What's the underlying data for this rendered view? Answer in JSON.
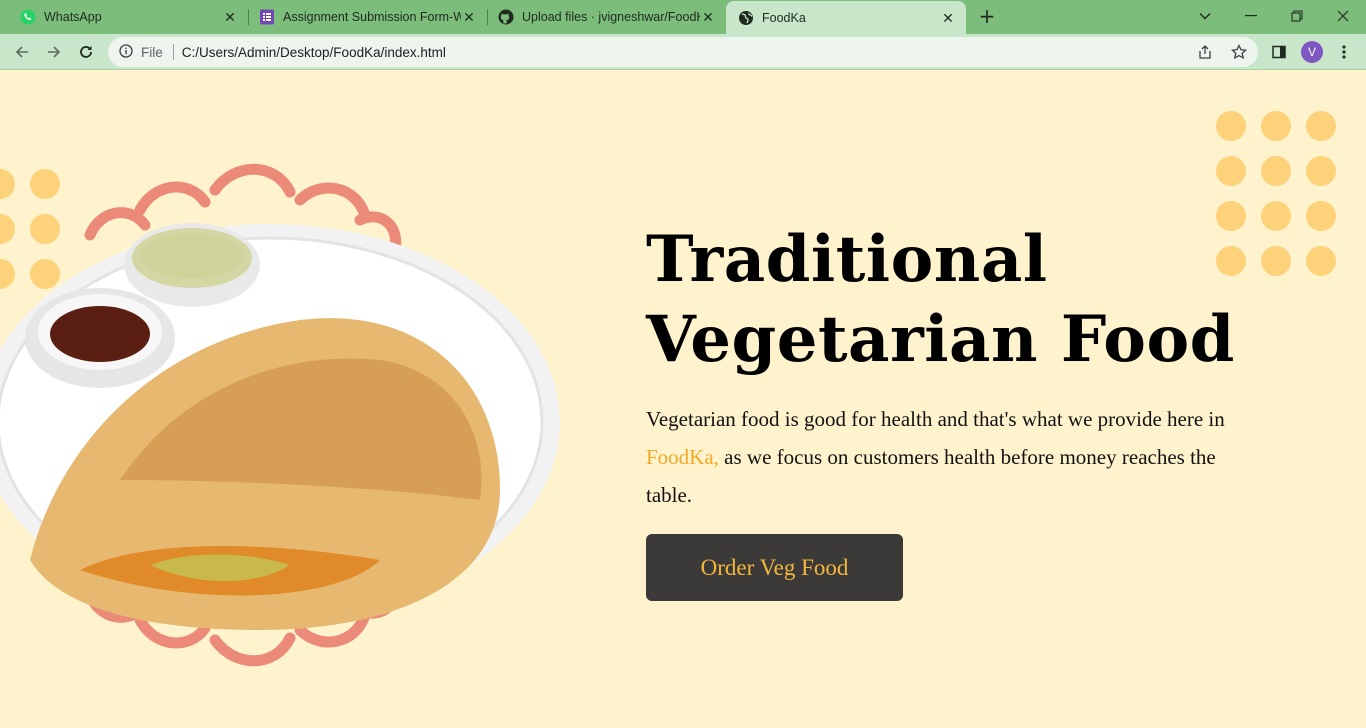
{
  "browser": {
    "tabs": [
      {
        "title": "WhatsApp",
        "icon": "whatsapp-icon",
        "active": false
      },
      {
        "title": "Assignment Submission Form-W",
        "icon": "google-forms-icon",
        "active": false
      },
      {
        "title": "Upload files · jvigneshwar/FoodKa",
        "icon": "github-icon",
        "active": false
      },
      {
        "title": "FoodKa",
        "icon": "globe-icon",
        "active": true
      }
    ],
    "address": {
      "scheme_label": "File",
      "url": "C:/Users/Admin/Desktop/FoodKa/index.html"
    },
    "profile_initial": "V"
  },
  "hero": {
    "headline_line1": "Traditional",
    "headline_line2": "Vegetarian Food",
    "desc_before": "Vegetarian food is good for health and that's what we provide here in ",
    "desc_brand": "FoodKa,",
    "desc_after": " as we focus on customers health before money reaches the table.",
    "cta_label": "Order Veg Food"
  },
  "colors": {
    "page_bg": "#fff3cd",
    "accent": "#f4a825",
    "dot": "#fdd27a",
    "button_bg": "#3b3a39",
    "tab_strip": "#7dbd7b",
    "toolbar": "#c8e6c9"
  }
}
